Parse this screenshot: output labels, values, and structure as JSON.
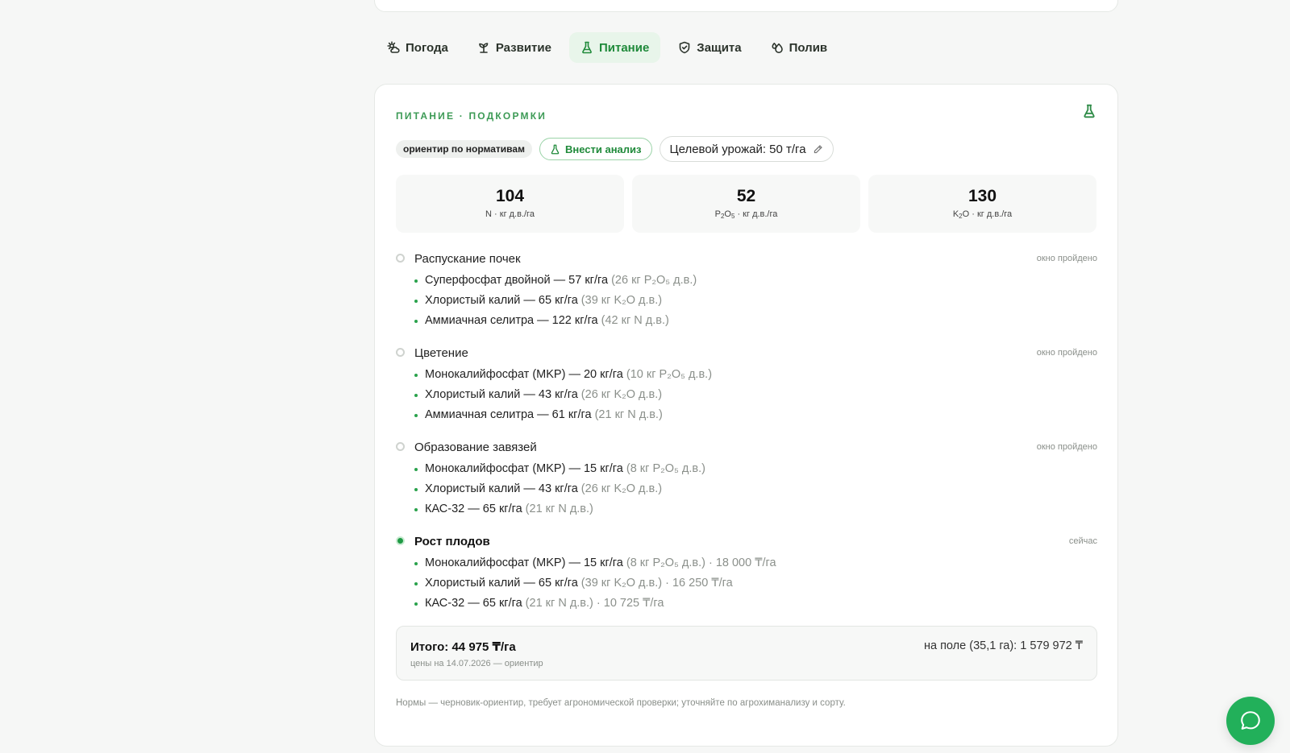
{
  "tabs": [
    {
      "label": "Погода",
      "icon": "weather-icon",
      "active": false
    },
    {
      "label": "Развитие",
      "icon": "sprout-icon",
      "active": false
    },
    {
      "label": "Питание",
      "icon": "flask-icon",
      "active": true
    },
    {
      "label": "Защита",
      "icon": "shield-icon",
      "active": false
    },
    {
      "label": "Полив",
      "icon": "droplets-icon",
      "active": false
    }
  ],
  "section": {
    "title": "ПИТАНИЕ · ПОДКОРМКИ",
    "chip_norms": "ориентир по нормативам",
    "chip_analysis": "Внести анализ",
    "chip_target": "Целевой урожай: 50 т/га"
  },
  "stats": [
    {
      "value": "104",
      "label_pre": "N · кг д.в./га"
    },
    {
      "value": "52",
      "label_pre": "P",
      "s1": "2",
      "mid": "O",
      "s2": "5",
      "post": " · кг д.в./га"
    },
    {
      "value": "130",
      "label_pre": "K",
      "s1": "2",
      "mid": "O",
      "post": " · кг д.в./га"
    }
  ],
  "stages": [
    {
      "name": "Распускание почек",
      "status": "окно пройдено",
      "items": [
        {
          "main": "Суперфосфат двойной — 57 кг/га",
          "note": "(26 кг P₂O₅ д.в.)"
        },
        {
          "main": "Хлористый калий — 65 кг/га",
          "note": "(39 кг K₂O д.в.)"
        },
        {
          "main": "Аммиачная селитра — 122 кг/га",
          "note": "(42 кг N д.в.)"
        }
      ]
    },
    {
      "name": "Цветение",
      "status": "окно пройдено",
      "items": [
        {
          "main": "Монокалийфосфат (MKP) — 20 кг/га",
          "note": "(10 кг P₂O₅ д.в.)"
        },
        {
          "main": "Хлористый калий — 43 кг/га",
          "note": "(26 кг K₂O д.в.)"
        },
        {
          "main": "Аммиачная селитра — 61 кг/га",
          "note": "(21 кг N д.в.)"
        }
      ]
    },
    {
      "name": "Образование завязей",
      "status": "окно пройдено",
      "items": [
        {
          "main": "Монокалийфосфат (MKP) — 15 кг/га",
          "note": "(8 кг P₂O₅ д.в.)"
        },
        {
          "main": "Хлористый калий — 43 кг/га",
          "note": "(26 кг K₂O д.в.)"
        },
        {
          "main": "КАС-32 — 65 кг/га",
          "note": "(21 кг N д.в.)"
        }
      ]
    },
    {
      "name": "Рост плодов",
      "status": "сейчас",
      "items": [
        {
          "main": "Монокалийфосфат (MKP) — 15 кг/га",
          "note": "(8 кг P₂O₅ д.в.) · 18 000 ₸/га"
        },
        {
          "main": "Хлористый калий — 65 кг/га",
          "note": "(39 кг K₂O д.в.) · 16 250 ₸/га"
        },
        {
          "main": "КАС-32 — 65 кг/га",
          "note": "(21 кг N д.в.) · 10 725 ₸/га"
        }
      ]
    }
  ],
  "totals": {
    "total": "Итого: 44 975 ₸/га",
    "prices_date": "цены на 14.07.2026 — ориентир",
    "field_total": "на поле (35,1 га): 1 579 972 ₸"
  },
  "footnote": "Нормы — черновик-ориентир, требует агрономической проверки; уточняйте по агрохиманализу и сорту.",
  "colors": {
    "accent": "#1f8a3a",
    "fab": "#22b05a"
  }
}
